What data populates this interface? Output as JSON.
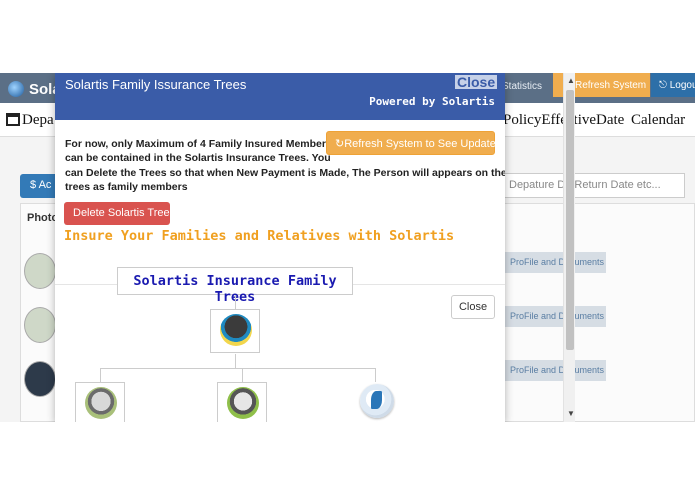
{
  "app": {
    "name": "Sola",
    "nav": {
      "statistics": "Statistics",
      "refresh": "Refresh System",
      "logout": "Logou"
    },
    "menu": [
      {
        "label": "Depa"
      },
      {
        "label": "PolicyEffectiveDate"
      },
      {
        "label": "Calendar"
      }
    ],
    "add_button": "$ Ac",
    "search_placeholder": "Depature Da Return Date etc...",
    "table": {
      "photo_header": "Photo",
      "profile_button": "ProFile and Documents"
    }
  },
  "modal": {
    "title": "Solartis Family Issurance Trees",
    "close_label": "Close",
    "powered_by": "Powered by Solartis",
    "refresh_button": "Refresh System to See Updates",
    "notice_lines": [
      "For now, only Maximum of 4 Family Insured Members",
      "can be contained in the Solartis Insurance Trees. You",
      "can Delete the Trees so that when New Payment is Made, The Person will appears on the",
      "trees as family members"
    ],
    "delete_button": "Delete Solartis Tree",
    "insure_text": "Insure Your Families and Relatives with Solartis",
    "tree_title": "Solartis Insurance Family Trees",
    "inner_close_button": "Close"
  },
  "icons": {
    "refresh": "refresh-icon",
    "logout": "logout-icon",
    "calendar": "calendar-icon",
    "dollar": "dollar-icon",
    "scroll_up": "scroll-up-arrow",
    "scroll_down": "scroll-down-arrow"
  },
  "colors": {
    "modal_header": "#3a5ca8",
    "refresh_button": "#f0ad4e",
    "delete_button": "#d9534f",
    "insure_text": "#f0a020",
    "tree_title": "#1a1ab0"
  }
}
